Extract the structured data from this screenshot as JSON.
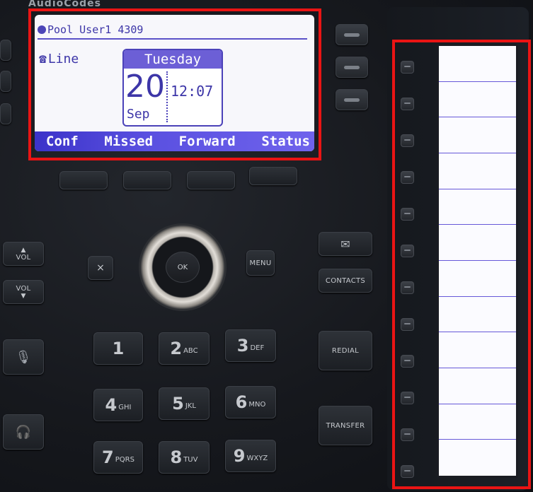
{
  "lcd": {
    "user_line": "Pool User1 4309",
    "line_label": "Line",
    "weekday": "Tuesday",
    "day": "20",
    "month": "Sep",
    "time": "12:07",
    "softkeys": [
      "Conf",
      "Missed",
      "Forward",
      "Status"
    ]
  },
  "keys": {
    "vol_up": "VOL",
    "vol_down": "VOL",
    "cancel": "×",
    "ok": "OK",
    "menu": "MENU",
    "contacts": "CONTACTS",
    "redial": "REDIAL",
    "transfer": "TRANSFER"
  },
  "keypad": [
    {
      "main": "1",
      "sub": ""
    },
    {
      "main": "2",
      "sub": "ABC"
    },
    {
      "main": "3",
      "sub": "DEF"
    },
    {
      "main": "4",
      "sub": "GHI"
    },
    {
      "main": "5",
      "sub": "JKL"
    },
    {
      "main": "6",
      "sub": "MNO"
    },
    {
      "main": "7",
      "sub": "PQRS"
    },
    {
      "main": "8",
      "sub": "TUV"
    },
    {
      "main": "9",
      "sub": "WXYZ"
    }
  ],
  "expansion_rows": 12,
  "colors": {
    "highlight": "#ea1414",
    "lcd_text": "#3d36a8",
    "softbar": "#5a50e0"
  }
}
